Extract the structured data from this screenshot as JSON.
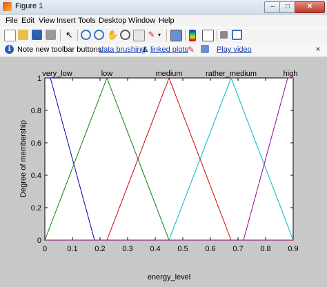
{
  "window": {
    "title": "Figure 1"
  },
  "menubar": {
    "items": [
      "File",
      "Edit",
      "View",
      "Insert",
      "Tools",
      "Desktop",
      "Window",
      "Help"
    ]
  },
  "toolbar": {
    "buttons": [
      "new-figure-icon",
      "open-file-icon",
      "save-icon",
      "print-icon",
      "edit-plot-icon",
      "zoom-in-icon",
      "zoom-out-icon",
      "pan-icon",
      "rotate-3d-icon",
      "data-cursor-icon",
      "brush-icon",
      "link-icon",
      "insert-colorbar-icon",
      "insert-legend-icon",
      "hide-plot-tools-icon",
      "show-plot-tools-icon"
    ]
  },
  "infobar": {
    "prefix": "Note new toolbar buttons:",
    "link1": "data brushing",
    "amp": "&",
    "link2": "linked plots",
    "link3": "Play video"
  },
  "chart_data": {
    "type": "line",
    "xlabel": "energy_level",
    "ylabel": "Degree of membership",
    "xlim": [
      0,
      0.9
    ],
    "ylim": [
      0,
      1
    ],
    "xticks": [
      "0",
      "0.1",
      "0.2",
      "0.3",
      "0.4",
      "0.5",
      "0.6",
      "0.7",
      "0.8",
      "0.9"
    ],
    "yticks": [
      "0",
      "0.2",
      "0.4",
      "0.6",
      "0.8",
      "1"
    ],
    "series": [
      {
        "name": "very_low",
        "color": "#0000b3",
        "x": [
          0,
          0.02,
          0.18
        ],
        "y": [
          1,
          1,
          0
        ]
      },
      {
        "name": "low",
        "color": "#007f00",
        "x": [
          0,
          0.225,
          0.45
        ],
        "y": [
          0,
          1,
          0
        ]
      },
      {
        "name": "medium",
        "color": "#cc0000",
        "x": [
          0.225,
          0.45,
          0.675
        ],
        "y": [
          0,
          1,
          0
        ]
      },
      {
        "name": "rather_medium",
        "color": "#00b3bf",
        "x": [
          0.45,
          0.675,
          0.9
        ],
        "y": [
          0,
          1,
          0
        ]
      },
      {
        "name": "high",
        "color": "#9a009a",
        "x": [
          0.72,
          0.88,
          0.9
        ],
        "y": [
          0,
          1,
          1
        ]
      }
    ],
    "baseline_color": "#8a006f",
    "series_labels": [
      {
        "text": "very_low",
        "x": 0.02
      },
      {
        "text": "low",
        "x": 0.225
      },
      {
        "text": "medium",
        "x": 0.45
      },
      {
        "text": "rather_medium",
        "x": 0.675
      },
      {
        "text": "high",
        "x": 0.9
      }
    ]
  }
}
